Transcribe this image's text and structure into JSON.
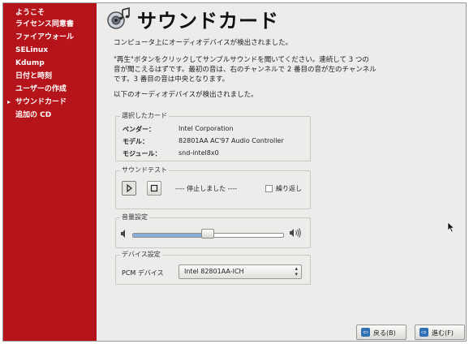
{
  "sidebar": {
    "items": [
      {
        "label": "ようこそ",
        "current": false
      },
      {
        "label": "ライセンス同意書",
        "current": false
      },
      {
        "label": "ファイアウォール",
        "current": false
      },
      {
        "label": "SELinux",
        "current": false
      },
      {
        "label": "Kdump",
        "current": false
      },
      {
        "label": "日付と時刻",
        "current": false
      },
      {
        "label": "ユーザーの作成",
        "current": false
      },
      {
        "label": "サウンドカード",
        "current": true
      },
      {
        "label": "追加の CD",
        "current": false
      }
    ]
  },
  "header": {
    "title": "サウンドカード",
    "icon": "sound-card-icon"
  },
  "intro": {
    "line1": "コンピュータ上にオーディオデバイスが検出されました。",
    "para_lines": [
      "\"再生\"ボタンをクリックしてサンプルサウンドを聞いてください。連続して 3 つの",
      "音が聞こえるはずです。最初の音は、右のチャンネルで 2 番目の音が左のチャンネル",
      "です。3 番目の音は中央となります。"
    ],
    "line3": "以下のオーディオデバイスが検出されました。"
  },
  "card": {
    "label": "選択したカード",
    "vendor_key": "ベンダー：",
    "vendor": "Intel Corporation",
    "model_key": "モデル：",
    "model": "82801AA AC'97 Audio Controller",
    "module_key": "モジュール：",
    "module": "snd-intel8x0"
  },
  "soundtest": {
    "label": "サウンドテスト",
    "play_icon": "play-icon",
    "stop_icon": "stop-icon",
    "status": "---- 停止しました ----",
    "repeat_label": "繰り返し",
    "repeat_checked": false
  },
  "volume": {
    "label": "音量設定",
    "level_percent": 50,
    "low_icon": "volume-low-icon",
    "high_icon": "volume-high-icon"
  },
  "device": {
    "label": "デバイス設定",
    "pcm_label": "PCM デバイス",
    "pcm_value": "Intel 82801AA-ICH"
  },
  "footer": {
    "back_label": "戻る(B)",
    "forward_label": "進む(F)"
  },
  "colors": {
    "sidebar_bg": "#b5141b",
    "window_bg": "#edeceb",
    "slider_fill": "#89aed8",
    "button_icon": "#2f6fb3"
  }
}
